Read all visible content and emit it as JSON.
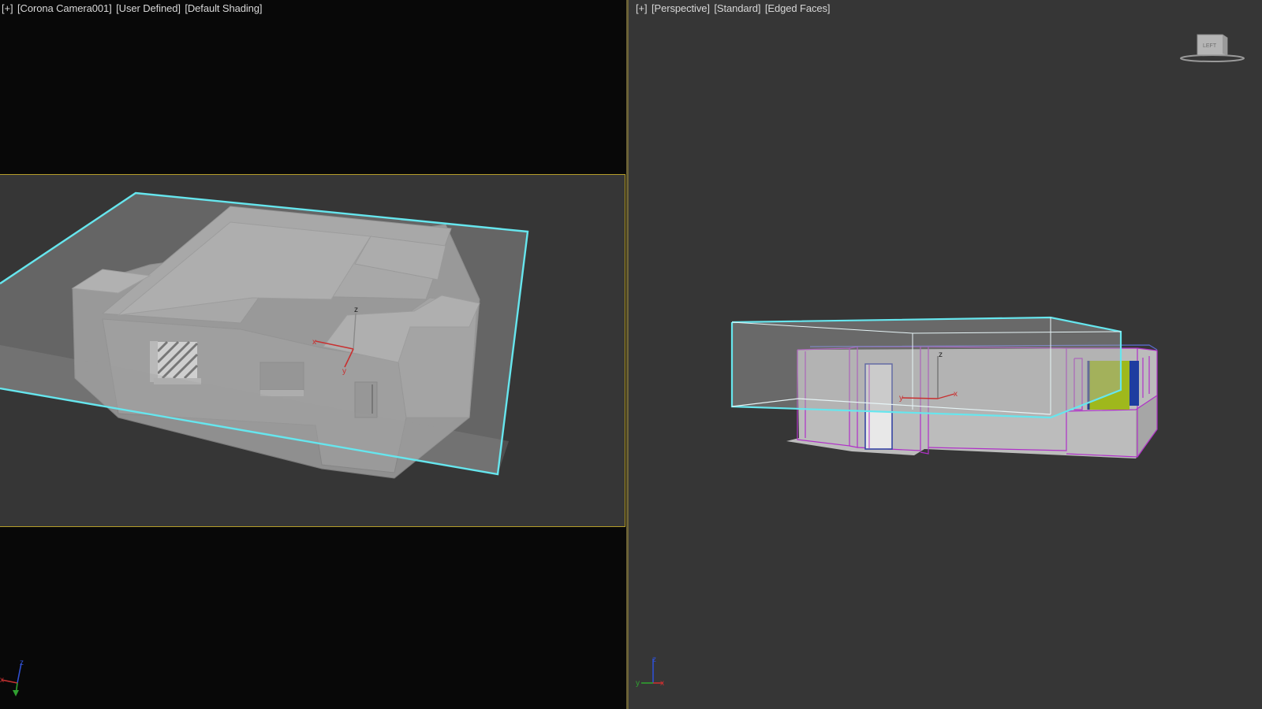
{
  "left_viewport": {
    "label": {
      "plus": "[+]",
      "camera": "[Corona Camera001]",
      "shading_mode": "[User Defined]",
      "shading": "[Default Shading]"
    },
    "gizmo": {
      "x": "x",
      "y": "y",
      "z": "z"
    },
    "corner_axis": {
      "x": "x",
      "z": "z"
    }
  },
  "right_viewport": {
    "label": {
      "plus": "[+]",
      "view": "[Perspective]",
      "mode": "[Standard]",
      "shading": "[Edged Faces]"
    },
    "gizmo": {
      "x": "x",
      "y": "y",
      "z": "z"
    },
    "corner_axis": {
      "x": "x",
      "y": "y",
      "z": "z"
    },
    "viewcube_face": "LEFT"
  },
  "colors": {
    "selection_box": "#66e6ee",
    "active_frame": "#b49d2a",
    "wireframe": "#b030c8",
    "axis_x": "#c83030",
    "axis_y": "#30a030",
    "axis_z": "#3050d0",
    "window_green": "#9fb81c",
    "window_blue": "#1e3ca0"
  }
}
